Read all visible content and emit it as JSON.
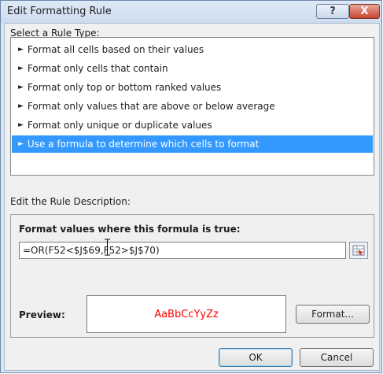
{
  "window": {
    "title": "Edit Formatting Rule",
    "help_label": "?",
    "close_label": "X"
  },
  "rule_type": {
    "label": "Select a Rule Type:",
    "items": [
      "Format all cells based on their values",
      "Format only cells that contain",
      "Format only top or bottom ranked values",
      "Format only values that are above or below average",
      "Format only unique or duplicate values",
      "Use a formula to determine which cells to format"
    ],
    "selected_index": 5
  },
  "description": {
    "label": "Edit the Rule Description:",
    "formula_heading": "Format values where this formula is true:",
    "formula_value": "=OR(F52<$J$69,F52>$J$70)"
  },
  "preview": {
    "label": "Preview:",
    "sample_text": "AaBbCcYyZz",
    "sample_color": "#ff0000"
  },
  "buttons": {
    "format": "Format...",
    "ok": "OK",
    "cancel": "Cancel"
  },
  "colors": {
    "selection": "#3399ff",
    "dialog_frame": "#dbe6f3",
    "close_button": "#c6452f"
  }
}
